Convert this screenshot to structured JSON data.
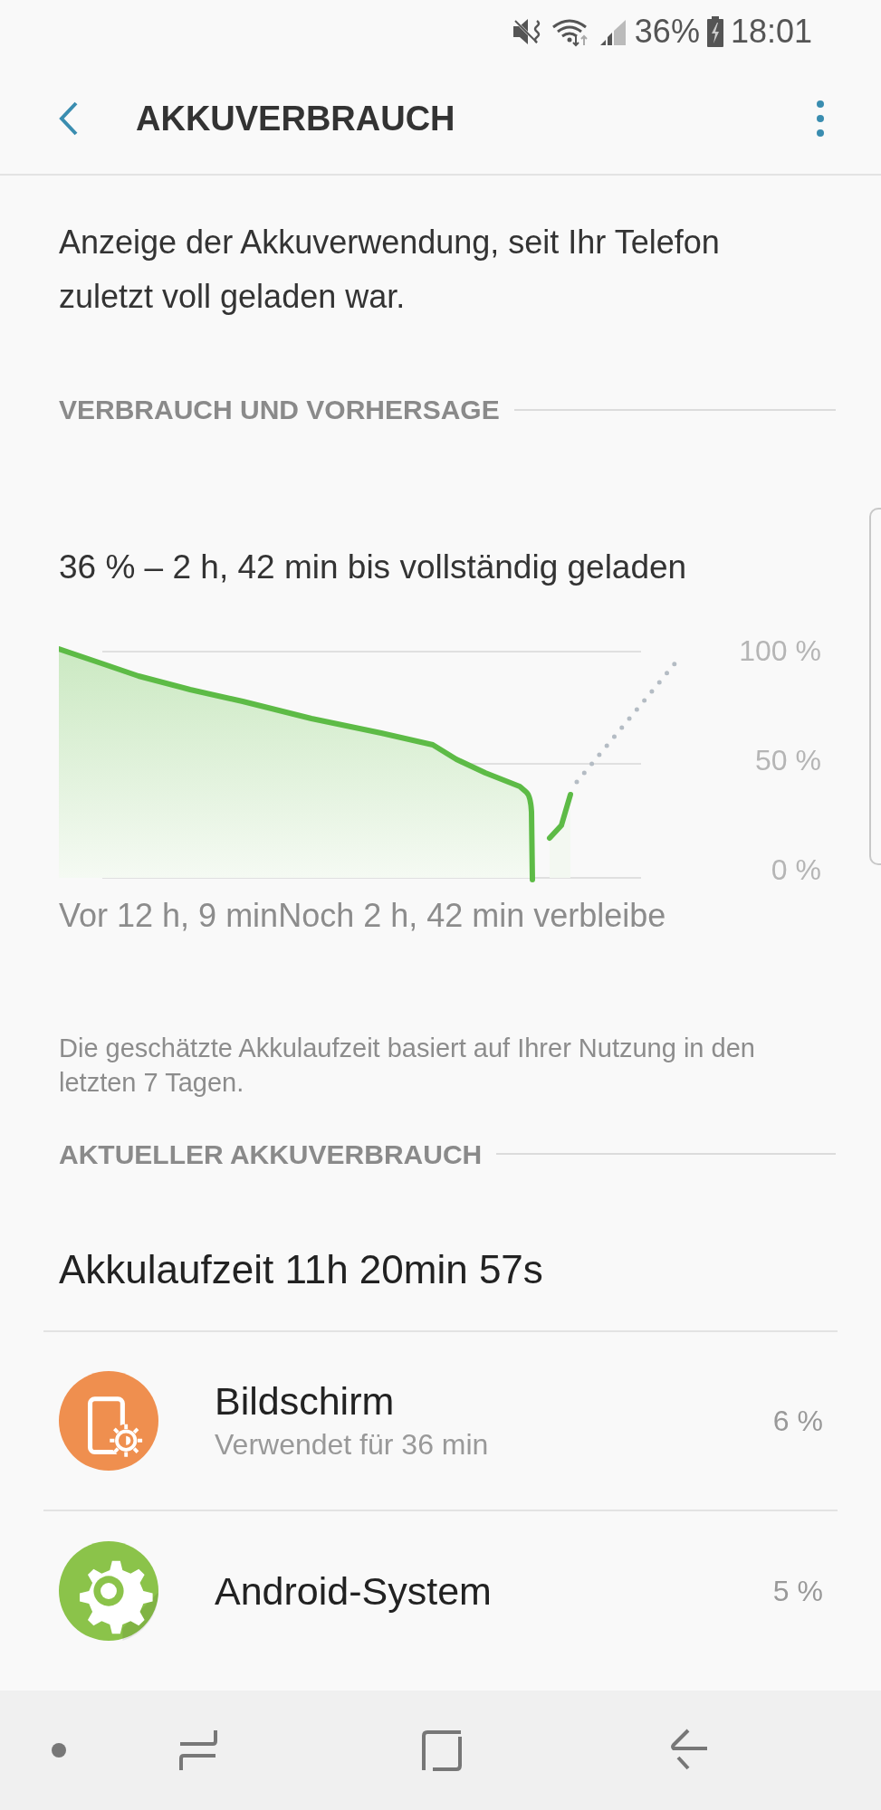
{
  "status_bar": {
    "battery": "36%",
    "time": "18:01"
  },
  "header": {
    "title": "AKKUVERBRAUCH"
  },
  "intro": "Anzeige der Akkuverwendung, seit Ihr Telefon zuletzt voll geladen war.",
  "usage_section": {
    "heading": "VERBRAUCH UND VORHERSAGE",
    "forecast": "36 % – 2 h, 42 min bis vollständig geladen",
    "chart": {
      "y_labels": [
        "100 %",
        "50 %",
        "0 %"
      ],
      "time_caption": "Vor 12 h, 9 minNoch 2 h, 42 min verbleibe"
    },
    "note": "Die geschätzte Akkulaufzeit basiert auf Ihrer Nutzung in den letzten 7 Tagen."
  },
  "current_section": {
    "heading": "AKTUELLER AKKUVERBRAUCH",
    "total": "Akkulaufzeit 11h 20min 57s",
    "items": [
      {
        "kind": "display",
        "color": "#ef8f4f",
        "name": "Bildschirm",
        "detail": "Verwendet für 36 min",
        "percent": "6 %"
      },
      {
        "kind": "system",
        "color": "#8bc34a",
        "name": "Android-System",
        "percent": "5 %"
      }
    ]
  }
}
